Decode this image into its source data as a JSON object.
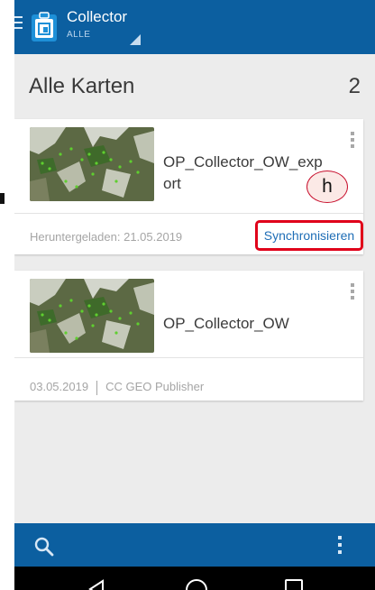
{
  "appbar": {
    "title": "Collector",
    "subtitle": "ALLE"
  },
  "section": {
    "title": "Alle Karten",
    "count": "2"
  },
  "maps": [
    {
      "title": "OP_Collector_OW_export",
      "downloaded_label": "Heruntergeladen:",
      "downloaded_date": "21.05.2019",
      "sync_label": "Synchronisieren"
    },
    {
      "title": "OP_Collector_OW",
      "date": "03.05.2019",
      "owner": "CC GEO Publisher"
    }
  ],
  "annotation": {
    "label": "h"
  },
  "icons": {
    "menu": "hamburger-icon",
    "logo": "collector-clipboard-icon",
    "dropdown": "dropdown-triangle-icon",
    "card_menu": "more-vertical-icon",
    "search": "search-icon",
    "overflow": "more-vertical-icon",
    "back": "back-triangle-icon",
    "home": "home-circle-icon",
    "recent": "recent-apps-square-icon"
  },
  "colors": {
    "primary": "#0c5fa0",
    "link": "#1e6db6",
    "highlight": "#e0001a",
    "background": "#ececec"
  }
}
